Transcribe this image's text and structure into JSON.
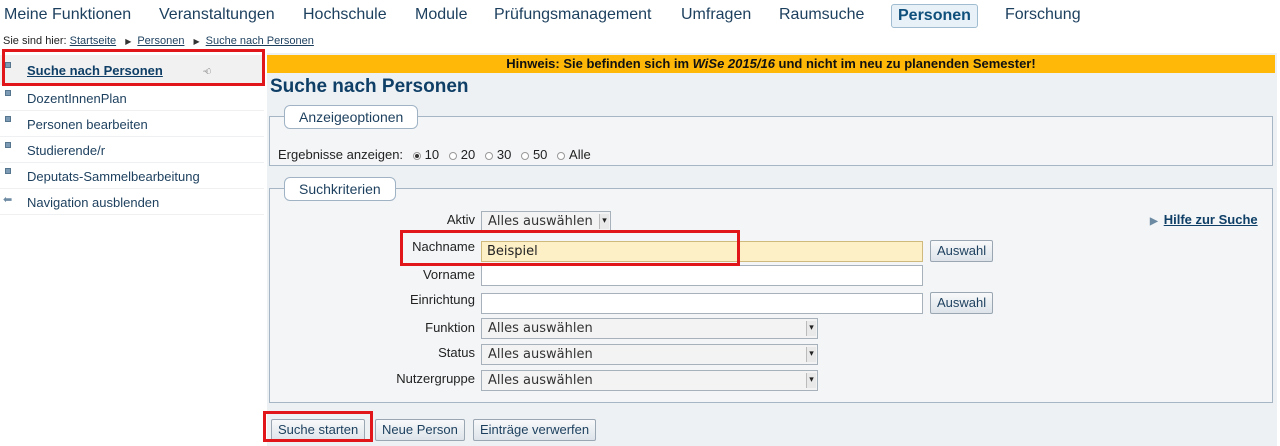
{
  "topnav": {
    "items": [
      {
        "label": "Meine Funktionen"
      },
      {
        "label": "Veranstaltungen"
      },
      {
        "label": "Hochschule"
      },
      {
        "label": "Module"
      },
      {
        "label": "Prüfungsmanagement"
      },
      {
        "label": "Umfragen"
      },
      {
        "label": "Raumsuche"
      },
      {
        "label": "Personen",
        "active": true
      },
      {
        "label": "Forschung"
      }
    ]
  },
  "breadcrumb": {
    "prefix": "Sie sind hier:",
    "items": [
      "Startseite",
      "Personen",
      "Suche nach Personen"
    ],
    "separator": "▶"
  },
  "sidebar": {
    "items": [
      {
        "label": "Suche nach Personen",
        "active": true,
        "icon": "square-bullet-icon"
      },
      {
        "label": "DozentInnenPlan",
        "icon": "square-bullet-icon"
      },
      {
        "label": "Personen bearbeiten",
        "icon": "square-bullet-icon"
      },
      {
        "label": "Studierende/r",
        "icon": "square-bullet-icon"
      },
      {
        "label": "Deputats-Sammelbearbeitung",
        "icon": "square-bullet-icon"
      },
      {
        "label": "Navigation ausblenden",
        "icon": "arrow-left-icon"
      }
    ]
  },
  "notice": {
    "before": "Hinweis: Sie befinden sich im ",
    "semester": "WiSe 2015/16",
    "after": " und nicht im neu zu planenden Semester!"
  },
  "page_title": "Suche nach Personen",
  "display_options": {
    "legend": "Anzeigeoptionen",
    "results_label": "Ergebnisse anzeigen:",
    "choices": [
      "10",
      "20",
      "30",
      "50",
      "Alle"
    ],
    "selected": "10"
  },
  "search_criteria": {
    "legend": "Suchkriterien",
    "help_link": "Hilfe zur Suche",
    "fields": {
      "aktiv": {
        "label": "Aktiv",
        "value": "Alles auswählen"
      },
      "nachname": {
        "label": "Nachname",
        "value": "Beispiel"
      },
      "vorname": {
        "label": "Vorname",
        "value": ""
      },
      "einrichtung": {
        "label": "Einrichtung",
        "value": ""
      },
      "funktion": {
        "label": "Funktion",
        "value": "Alles auswählen"
      },
      "status": {
        "label": "Status",
        "value": "Alles auswählen"
      },
      "nutzergruppe": {
        "label": "Nutzergruppe",
        "value": "Alles auswählen"
      }
    },
    "auswahl_label": "Auswahl"
  },
  "actions": {
    "search": "Suche starten",
    "new_person": "Neue Person",
    "discard": "Einträge verwerfen"
  },
  "colors": {
    "notice_bg": "#ffb808",
    "highlight_box": "#e0161b",
    "link": "#0f3f66"
  }
}
